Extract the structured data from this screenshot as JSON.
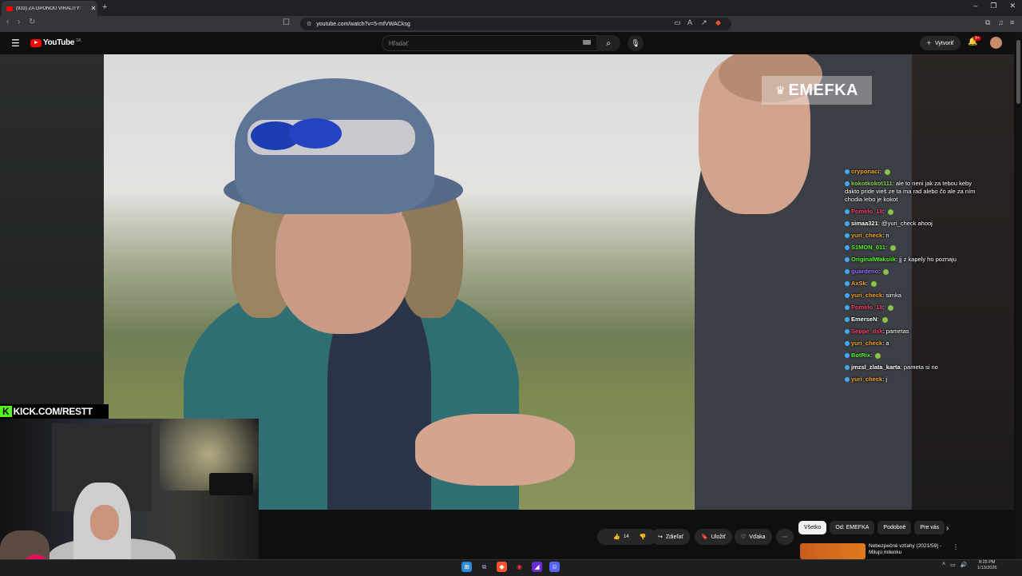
{
  "browser": {
    "tab_title": "(933) ZA OPONOU VIRALITY:",
    "new_tab": "+",
    "url": "youtube.com/watch?v=5-mfVWACksg",
    "window_controls": [
      "–",
      "❐",
      "✕"
    ]
  },
  "youtube": {
    "logo_text": "YouTube",
    "region": "SK",
    "search_placeholder": "Hľadať",
    "create_label": "Vytvoriť",
    "notif_badge": "9+"
  },
  "video": {
    "watermark": "EMEFKA"
  },
  "chat": [
    {
      "user": "cryponaci",
      "msg": ""
    },
    {
      "user": "kokotkokot111",
      "msg": "ale to neni jak za tebou keby dakto pride vieš ze ta ma rad alebo čo ale za ním chodia lebo je kokot"
    },
    {
      "user": "Pomelo_18",
      "msg": ""
    },
    {
      "user": "simaa321",
      "msg": "@yuri_check ahooj"
    },
    {
      "user": "yuri_check",
      "msg": "n"
    },
    {
      "user": "S1MON_011",
      "msg": ""
    },
    {
      "user": "OriginalWaksiik",
      "msg": "jj z kapely ho poznaju"
    },
    {
      "user": "guardeno",
      "msg": ""
    },
    {
      "user": "AxSk",
      "msg": ""
    },
    {
      "user": "yuri_check",
      "msg": "simka"
    },
    {
      "user": "Pomelo_18",
      "msg": ""
    },
    {
      "user": "EmerseN",
      "msg": ""
    },
    {
      "user": "Seppe_dsk",
      "msg": "pametas"
    },
    {
      "user": "yuri_check",
      "msg": "a"
    },
    {
      "user": "BotRix",
      "msg": ""
    },
    {
      "user": "jmzsl_zlata_karta",
      "msg": "pameta si no"
    },
    {
      "user": "yuri_check",
      "msg": "j"
    }
  ],
  "stream": {
    "kick_logo": "K",
    "kick_url": "KICK.COM/RESTT"
  },
  "actions": {
    "like_count": "14",
    "dislike": "",
    "share": "Zdieľať",
    "save": "Uložiť",
    "thanks": "Vďaka",
    "more": "⋯"
  },
  "chips": [
    "Všetko",
    "Od: EMEFKA",
    "Podobné",
    "Pre vás"
  ],
  "recommended": {
    "title": "Nebezpečné vzťahy (2021/59) - Milujú milenku"
  },
  "taskbar": {
    "time": "8:25 PM",
    "date": "1/13/2026"
  },
  "colors": {
    "youtube_red": "#ff0000",
    "kick_green": "#53fc18"
  }
}
